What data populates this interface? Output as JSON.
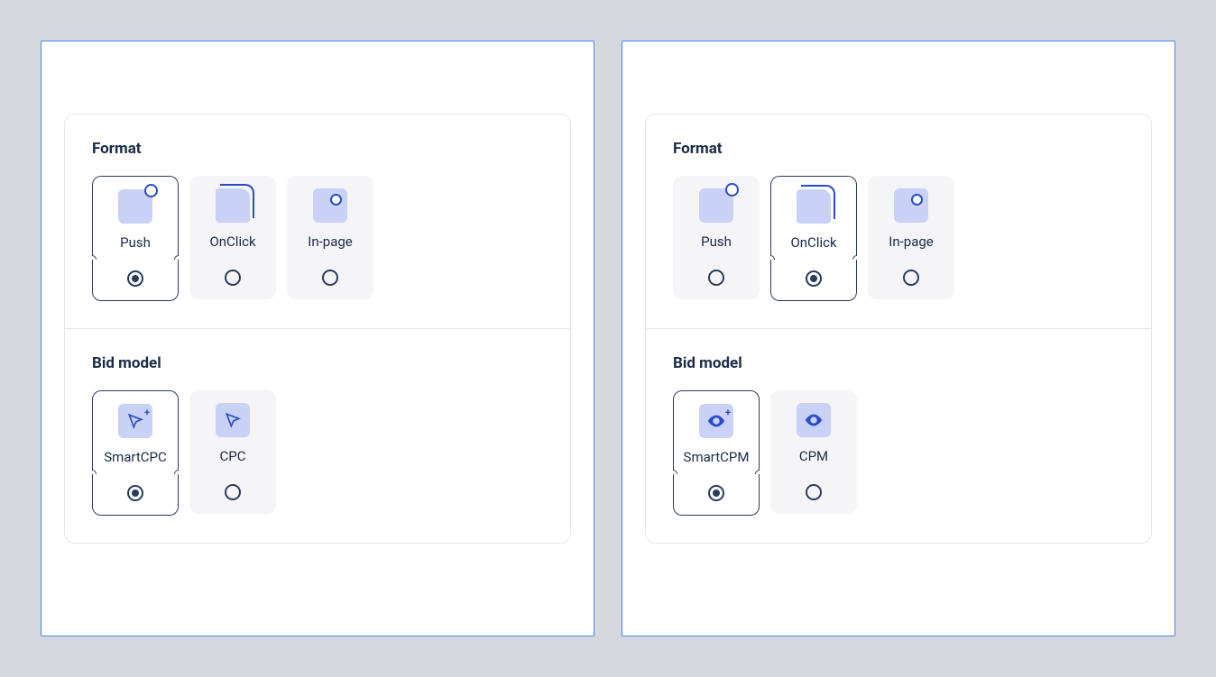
{
  "panels": [
    {
      "format": {
        "title": "Format",
        "options": [
          {
            "label": "Push",
            "icon": "push",
            "selected": true
          },
          {
            "label": "OnClick",
            "icon": "onclick",
            "selected": false
          },
          {
            "label": "In-page",
            "icon": "inpage",
            "selected": false
          }
        ]
      },
      "bid_model": {
        "title": "Bid model",
        "options": [
          {
            "label": "SmartCPC",
            "icon": "cursor-plus",
            "selected": true
          },
          {
            "label": "CPC",
            "icon": "cursor",
            "selected": false
          }
        ]
      }
    },
    {
      "format": {
        "title": "Format",
        "options": [
          {
            "label": "Push",
            "icon": "push",
            "selected": false
          },
          {
            "label": "OnClick",
            "icon": "onclick",
            "selected": true
          },
          {
            "label": "In-page",
            "icon": "inpage",
            "selected": false
          }
        ]
      },
      "bid_model": {
        "title": "Bid model",
        "options": [
          {
            "label": "SmartCPM",
            "icon": "eye-plus",
            "selected": true
          },
          {
            "label": "CPM",
            "icon": "eye",
            "selected": false
          }
        ]
      }
    }
  ]
}
